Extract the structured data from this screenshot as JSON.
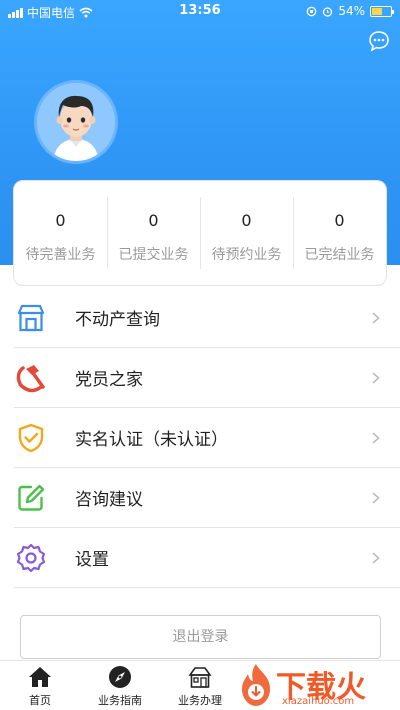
{
  "status_bar": {
    "carrier": "中国电信",
    "time": "13:56",
    "battery_percent": "54%",
    "battery_level": 0.54
  },
  "header": {
    "message_icon": "chat-bubble-icon",
    "avatar": "user-avatar"
  },
  "stats": [
    {
      "value": "0",
      "label": "待完善业务"
    },
    {
      "value": "0",
      "label": "已提交业务"
    },
    {
      "value": "0",
      "label": "待预约业务"
    },
    {
      "value": "0",
      "label": "已完结业务"
    }
  ],
  "menu": [
    {
      "label": "不动产查询",
      "icon": "house-icon",
      "color": "#3a8ee6"
    },
    {
      "label": "党员之家",
      "icon": "hammer-sickle-icon",
      "color": "#e24a3b"
    },
    {
      "label": "实名认证（未认证）",
      "icon": "shield-check-icon",
      "color": "#f2a81d"
    },
    {
      "label": "咨询建议",
      "icon": "edit-icon",
      "color": "#4cc04a"
    },
    {
      "label": "设置",
      "icon": "gear-icon",
      "color": "#8a5bd6"
    }
  ],
  "logout_label": "退出登录",
  "tabbar": [
    {
      "label": "首页",
      "icon": "home-icon"
    },
    {
      "label": "业务指南",
      "icon": "compass-icon"
    },
    {
      "label": "业务办理",
      "icon": "building-icon"
    }
  ],
  "watermark": {
    "text": "下载火",
    "url": "xiazaihuo.com"
  },
  "colors": {
    "header_blue": "#2f96f5",
    "accent_orange": "#ef5a28"
  }
}
